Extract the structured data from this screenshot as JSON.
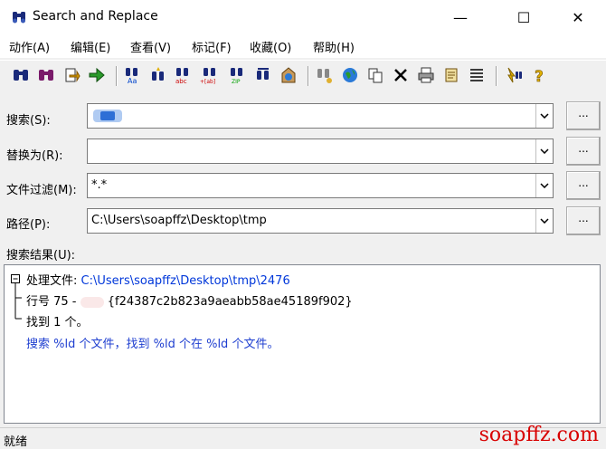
{
  "window": {
    "title": "Search and Replace",
    "minimize": "—",
    "maximize": "☐",
    "close": "✕"
  },
  "menu": [
    "动作(A)",
    "编辑(E)",
    "查看(V)",
    "标记(F)",
    "收藏(O)",
    "帮助(H)"
  ],
  "fields": {
    "search": {
      "label": "搜索(S):",
      "value": ""
    },
    "replace": {
      "label": "替换为(R):",
      "value": ""
    },
    "filter": {
      "label": "文件过滤(M):",
      "value": "*.*"
    },
    "path": {
      "label": "路径(P):",
      "value": "C:\\Users\\soapffz\\Desktop\\tmp"
    },
    "browse_label": "..."
  },
  "results": {
    "label": "搜索结果(U):",
    "processing_prefix": "处理文件: ",
    "processing_file": "C:\\Users\\soapffz\\Desktop\\tmp\\2476",
    "line_prefix": "行号  75 -",
    "line_text": "{f24387c2b823a9aeabb58ae45189f902}",
    "found": "找到 1 个。",
    "summary": "搜索 %ld 个文件，找到 %ld 个在 %ld 个文件。"
  },
  "status": "就绪",
  "watermark": "soapffz.com",
  "colors": {
    "link": "#0037da",
    "summary": "#1f3fd0",
    "accent": "#1e6fd9"
  },
  "toolbar_icons": [
    "find-icon",
    "find-multi-icon",
    "open-file-icon",
    "goto-icon",
    "search-aa-icon",
    "search-star-icon",
    "search-abc-icon",
    "search-brackets-icon",
    "search-zip-icon",
    "replace-icon",
    "web-icon",
    "search-gray-icon",
    "globe-icon",
    "copy-icon",
    "delete-icon",
    "print-icon",
    "scroll-icon",
    "list-icon",
    "advanced-icon",
    "help-icon"
  ]
}
